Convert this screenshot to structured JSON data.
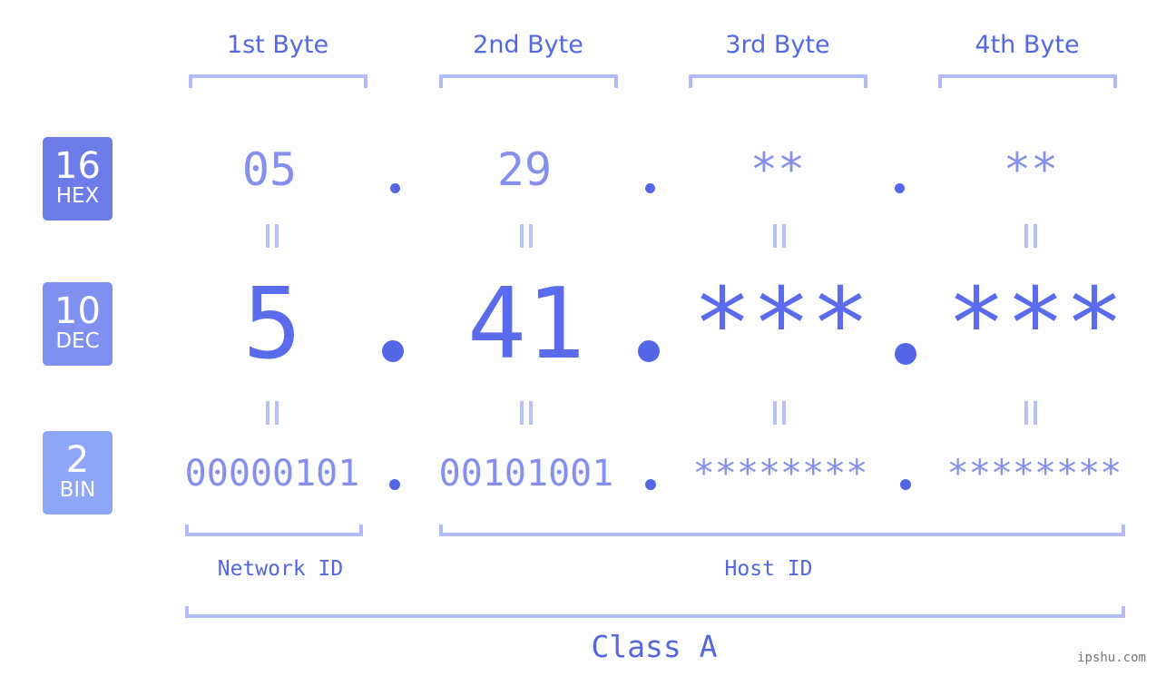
{
  "rows": {
    "hex": {
      "base": "16",
      "label": "HEX",
      "values": [
        "05",
        "29",
        "**",
        "**"
      ]
    },
    "dec": {
      "base": "10",
      "label": "DEC",
      "values": [
        "5",
        "41",
        "***",
        "***"
      ]
    },
    "bin": {
      "base": "2",
      "label": "BIN",
      "values": [
        "00000101",
        "00101001",
        "********",
        "********"
      ]
    }
  },
  "bytes": [
    "1st Byte",
    "2nd Byte",
    "3rd Byte",
    "4th Byte"
  ],
  "separator": ".",
  "network_label": "Network ID",
  "host_label": "Host ID",
  "class_label": "Class A",
  "watermark": "ipshu.com",
  "colors": {
    "hex_badge": "#6d7ce8",
    "dec_badge": "#8090f0",
    "bin_badge": "#8ea6f8",
    "accent": "#5466e6",
    "bracket": "#b2bbf6"
  }
}
